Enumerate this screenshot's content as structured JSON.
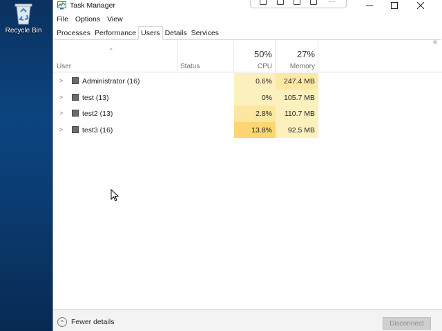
{
  "desktop": {
    "recycle_bin_label": "Recycle Bin"
  },
  "window": {
    "title": "Task Manager",
    "app_icon": "task-manager-icon",
    "snip_toolbar_icons": [
      "rect-snip-icon",
      "window-snip-icon",
      "fullscreen-snip-icon",
      "freeform-snip-icon",
      "more-icon"
    ],
    "controls": [
      "minimize-icon",
      "maximize-icon",
      "close-icon"
    ]
  },
  "menu": {
    "items": [
      "File",
      "Options",
      "View"
    ]
  },
  "tabs": {
    "items": [
      "Processes",
      "Performance",
      "Users",
      "Details",
      "Services"
    ],
    "active": "Users"
  },
  "columns": {
    "user": "User",
    "status": "Status",
    "cpu": {
      "label": "CPU",
      "total": "50%"
    },
    "memory": {
      "label": "Memory",
      "total": "27%"
    }
  },
  "rows": [
    {
      "user": "Administrator (16)",
      "status": "",
      "cpu": "0.6%",
      "memory": "247.4 MB",
      "cpu_heat": "#fdf0bf",
      "mem_heat": "#fde9a6"
    },
    {
      "user": "test (13)",
      "status": "",
      "cpu": "0%",
      "memory": "105.7 MB",
      "cpu_heat": "#fdf0bf",
      "mem_heat": "#fdf0bf"
    },
    {
      "user": "test2 (13)",
      "status": "",
      "cpu": "2.8%",
      "memory": "110.7 MB",
      "cpu_heat": "#fde6a0",
      "mem_heat": "#fdf0bf"
    },
    {
      "user": "test3 (16)",
      "status": "",
      "cpu": "13.8%",
      "memory": "92.5 MB",
      "cpu_heat": "#fbd673",
      "mem_heat": "#fdf0bf"
    }
  ],
  "footer": {
    "fewer_details": "Fewer details",
    "disconnect": "Disconnect"
  }
}
